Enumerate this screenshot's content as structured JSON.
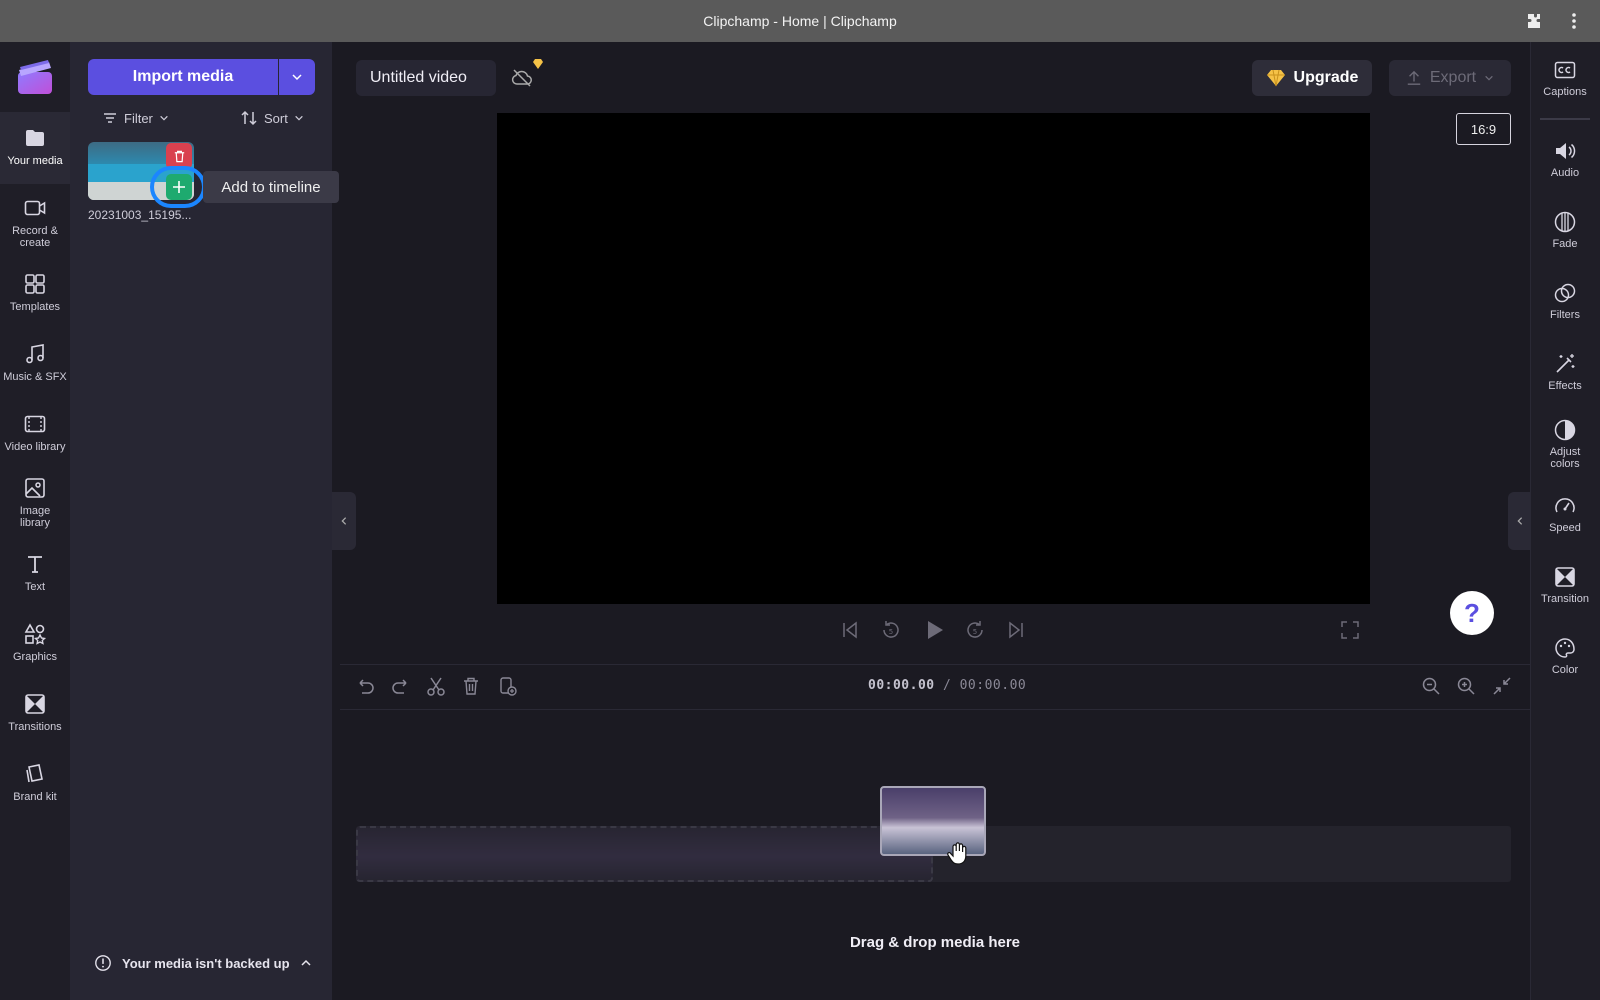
{
  "window": {
    "title": "Clipchamp - Home | Clipchamp"
  },
  "leftnav": {
    "items": [
      {
        "label": "Your media",
        "icon": "folder-icon"
      },
      {
        "label": "Record & create",
        "icon": "camera-icon"
      },
      {
        "label": "Templates",
        "icon": "templates-icon"
      },
      {
        "label": "Music & SFX",
        "icon": "music-icon"
      },
      {
        "label": "Video library",
        "icon": "film-icon"
      },
      {
        "label": "Image library",
        "icon": "image-icon"
      },
      {
        "label": "Text",
        "icon": "text-icon"
      },
      {
        "label": "Graphics",
        "icon": "shapes-icon"
      },
      {
        "label": "Transitions",
        "icon": "transition-icon"
      },
      {
        "label": "Brand kit",
        "icon": "brand-icon"
      }
    ]
  },
  "media": {
    "import_label": "Import media",
    "filter_label": "Filter",
    "sort_label": "Sort",
    "file_name": "20231003_15195...",
    "tooltip": "Add to timeline",
    "backup_warning": "Your media isn't backed up"
  },
  "editor": {
    "project_title": "Untitled video",
    "upgrade_label": "Upgrade",
    "export_label": "Export",
    "aspect_ratio": "16:9",
    "help_label": "?"
  },
  "timeline": {
    "current_time": "00:00.00",
    "separator": "/",
    "total_time": "00:00.00",
    "drop_message": "Drag & drop media here"
  },
  "rightpanel": {
    "items": [
      {
        "label": "Captions",
        "icon": "captions-icon"
      },
      {
        "label": "Audio",
        "icon": "speaker-icon"
      },
      {
        "label": "Fade",
        "icon": "fade-icon"
      },
      {
        "label": "Filters",
        "icon": "filters-icon"
      },
      {
        "label": "Effects",
        "icon": "magic-wand-icon"
      },
      {
        "label": "Adjust colors",
        "icon": "contrast-icon"
      },
      {
        "label": "Speed",
        "icon": "speedometer-icon"
      },
      {
        "label": "Transition",
        "icon": "transition-icon"
      },
      {
        "label": "Color",
        "icon": "palette-icon"
      }
    ]
  },
  "colors": {
    "accent": "#5b4fe0",
    "delete": "#d9414f",
    "add": "#1eaa6f",
    "highlight": "#1b86ff"
  }
}
